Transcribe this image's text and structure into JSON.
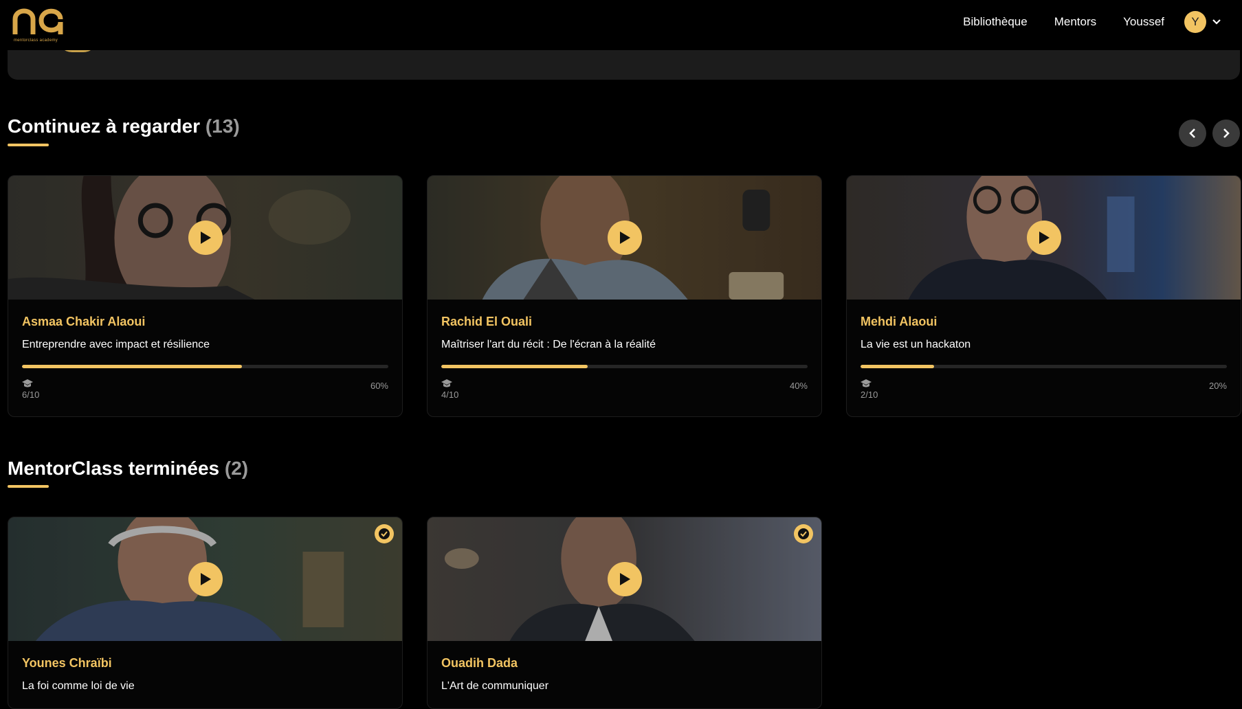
{
  "header": {
    "logo_caption": "mentorclass academy",
    "nav": [
      "Bibliothèque",
      "Mentors",
      "Youssef"
    ],
    "avatar_initial": "Y"
  },
  "colors": {
    "accent": "#f2c462",
    "background": "#000000",
    "card_bg": "#050505",
    "muted": "#9a9a9a"
  },
  "continue_section": {
    "title": "Continuez à regarder",
    "count": "(13)",
    "cards": [
      {
        "mentor": "Asmaa Chakir Alaoui",
        "course": "Entreprendre avec impact et résilience",
        "episodes": "6/10",
        "percent_label": "60%",
        "progress": 0.6
      },
      {
        "mentor": "Rachid El Ouali",
        "course": "Maîtriser l'art du récit : De l'écran à la réalité",
        "episodes": "4/10",
        "percent_label": "40%",
        "progress": 0.4
      },
      {
        "mentor": "Mehdi Alaoui",
        "course": "La vie est un hackaton",
        "episodes": "2/10",
        "percent_label": "20%",
        "progress": 0.2
      }
    ]
  },
  "completed_section": {
    "title": "MentorClass terminées",
    "count": "(2)",
    "cards": [
      {
        "mentor": "Younes Chraïbi",
        "course": "La foi comme loi de vie"
      },
      {
        "mentor": "Ouadih Dada",
        "course": "L'Art de communiquer"
      }
    ]
  },
  "icons": [
    "play-icon",
    "check-circle-icon",
    "graduation-cap-icon",
    "chevron-left-icon",
    "chevron-right-icon",
    "chevron-down-icon"
  ]
}
